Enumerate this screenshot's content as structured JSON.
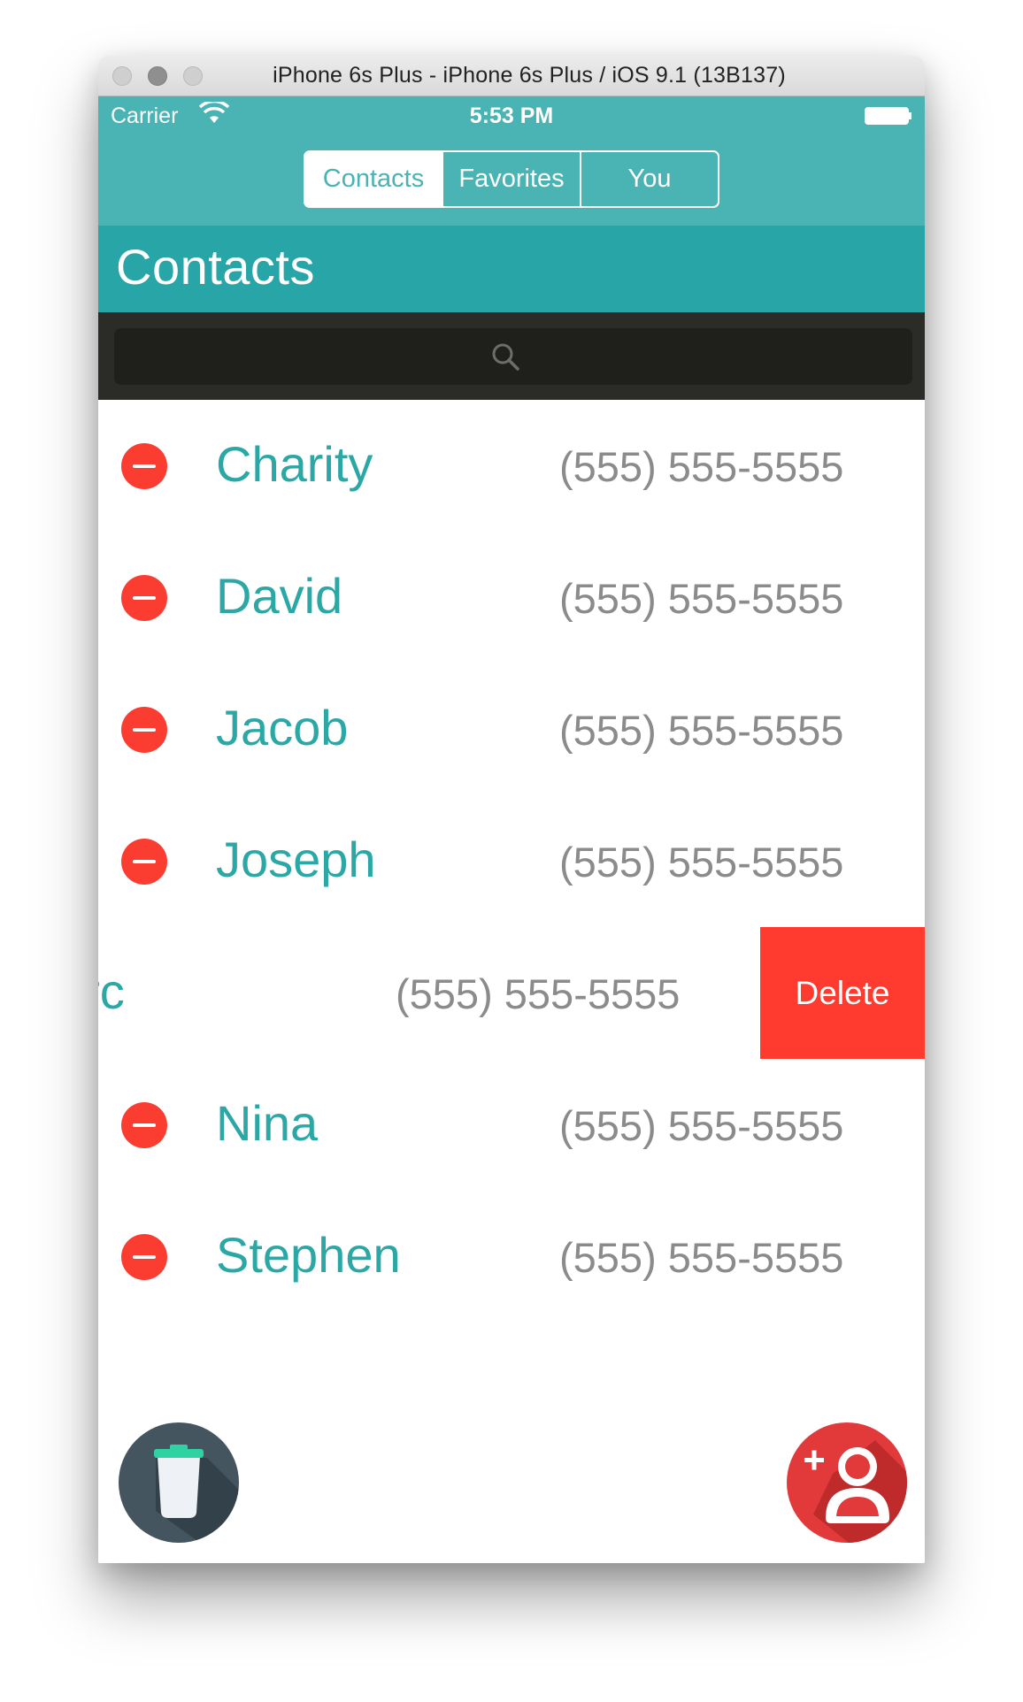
{
  "window": {
    "title": "iPhone 6s Plus - iPhone 6s Plus / iOS 9.1 (13B137)"
  },
  "status_bar": {
    "carrier": "Carrier",
    "time": "5:53 PM"
  },
  "tabs": [
    {
      "label": "Contacts",
      "active": true
    },
    {
      "label": "Favorites",
      "active": false
    },
    {
      "label": "You",
      "active": false
    }
  ],
  "header": {
    "title": "Contacts"
  },
  "search": {
    "placeholder": ""
  },
  "contacts": [
    {
      "name": "Charity",
      "phone": "(555) 555-5555"
    },
    {
      "name": "David",
      "phone": "(555) 555-5555"
    },
    {
      "name": "Jacob",
      "phone": "(555) 555-5555"
    },
    {
      "name": "Joseph",
      "phone": "(555) 555-5555"
    },
    {
      "name": "arc",
      "phone": "(555) 555-5555",
      "swiped": true,
      "action": "Delete"
    },
    {
      "name": "Nina",
      "phone": "(555) 555-5555"
    },
    {
      "name": "Stephen",
      "phone": "(555) 555-5555"
    }
  ],
  "colors": {
    "nav": "#4ab3b3",
    "header": "#27a5a7",
    "name_text": "#2ba7a6",
    "delete": "#ff3a2f",
    "trash_fab": "#45555f",
    "add_fab": "#e23a3a"
  },
  "icons": {
    "trash_fab": "trash-icon",
    "add_fab": "add-person-icon"
  }
}
